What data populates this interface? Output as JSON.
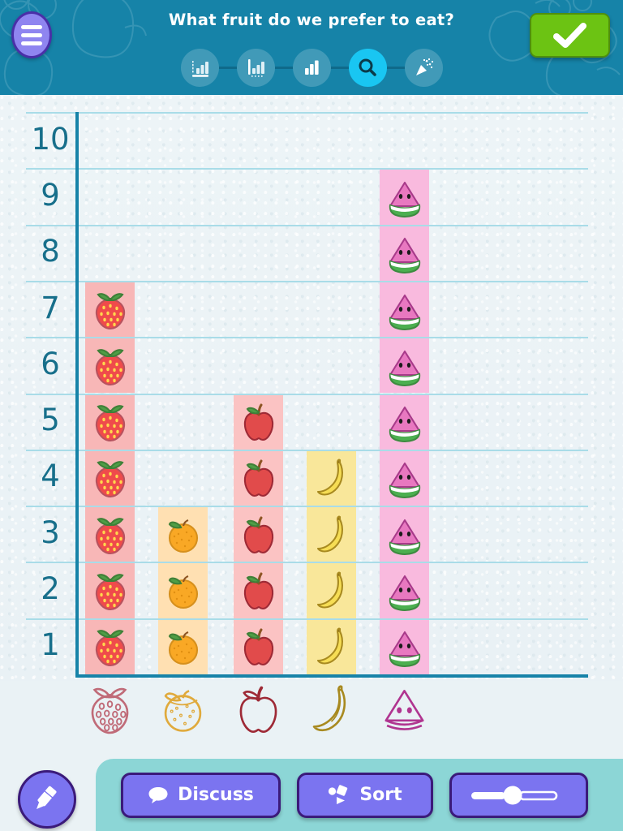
{
  "header": {
    "title": "What fruit do we prefer to eat?",
    "menu_icon": "hamburger-menu-icon",
    "confirm_icon": "checkmark-icon",
    "teal": "#1683a8",
    "confirm_color": "#6cc313",
    "steps": [
      {
        "name": "step-axis-chart",
        "icon": "bar-chart-axis-icon",
        "active": false
      },
      {
        "name": "step-scale-chart",
        "icon": "bar-chart-scale-icon",
        "active": false
      },
      {
        "name": "step-bar-chart",
        "icon": "bar-chart-icon",
        "active": false
      },
      {
        "name": "step-inspect",
        "icon": "magnifier-icon",
        "active": true
      },
      {
        "name": "step-celebrate",
        "icon": "party-popper-icon",
        "active": false
      }
    ]
  },
  "chart_data": {
    "type": "bar",
    "title": "What fruit do we prefer to eat?",
    "xlabel": "",
    "ylabel": "",
    "ylim": [
      0,
      10
    ],
    "yticks": [
      "1",
      "2",
      "3",
      "4",
      "5",
      "6",
      "7",
      "8",
      "9",
      "10"
    ],
    "grid": true,
    "legend": "none",
    "categories": [
      "strawberry",
      "orange",
      "apple",
      "banana",
      "watermelon"
    ],
    "values": [
      7,
      3,
      5,
      4,
      9
    ],
    "bars": [
      {
        "label": "strawberry",
        "value": 7,
        "column_color": "#f8b7b7",
        "icon": "strawberry-icon"
      },
      {
        "label": "orange",
        "value": 3,
        "column_color": "#ffe0b2",
        "icon": "orange-icon"
      },
      {
        "label": "apple",
        "value": 5,
        "column_color": "#fbc3c3",
        "icon": "apple-icon"
      },
      {
        "label": "banana",
        "value": 4,
        "column_color": "#f9e79a",
        "icon": "banana-icon"
      },
      {
        "label": "watermelon",
        "value": 9,
        "column_color": "#f9bade",
        "icon": "watermelon-icon"
      }
    ],
    "axis_color": "#1683a8",
    "gridline_color": "#a9dce8",
    "tick_label_color": "#176f8b"
  },
  "toolbar": {
    "edit_icon": "pencil-icon",
    "discuss_label": "Discuss",
    "discuss_icon": "speech-bubble-icon",
    "sort_label": "Sort",
    "sort_icon": "shapes-sort-icon",
    "slider_label": "",
    "slider_icon": "slider-icon",
    "button_color": "#7b74f0",
    "panel_color": "#8cd6d6"
  }
}
